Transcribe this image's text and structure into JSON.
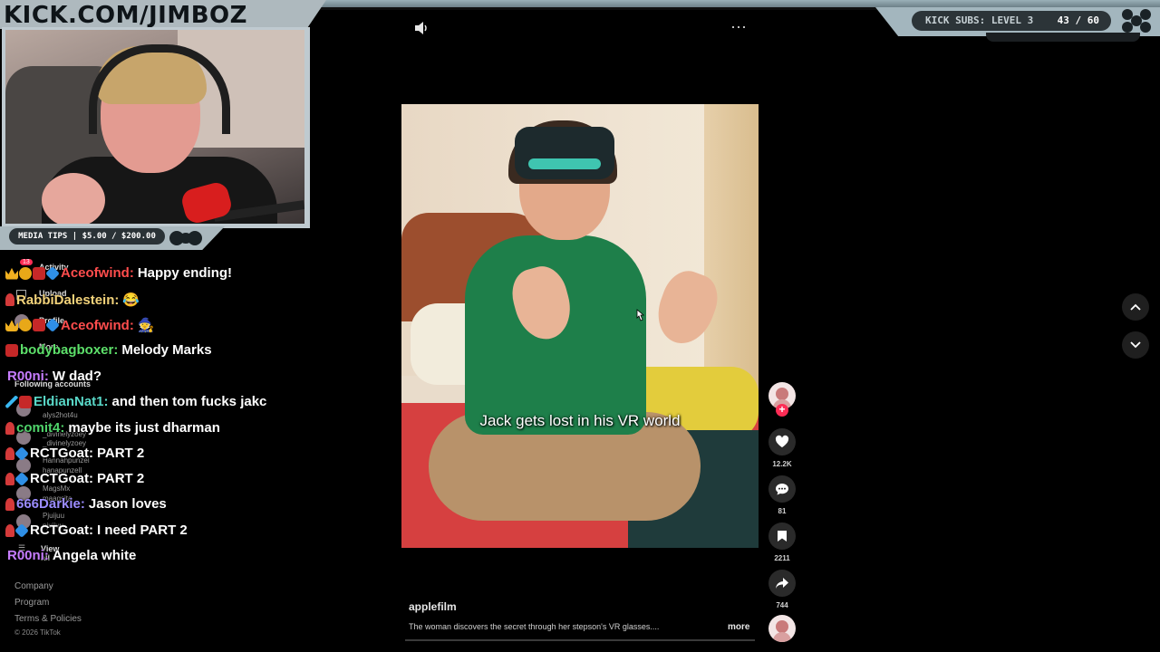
{
  "overlay": {
    "channel_title": "KICK.COM/JIMBOZ",
    "media_tips": "MEDIA TIPS | $5.00 / $200.00",
    "subs_label": "KICK SUBS: LEVEL 3",
    "subs_count": "43 / 60"
  },
  "sidebar": {
    "activity_badge": "13",
    "activity": "Activity",
    "upload": "Upload",
    "profile": "Profile",
    "more": "More",
    "following_title": "Following accounts",
    "accounts": [
      {
        "name": "",
        "handle": "alys2hot4u"
      },
      {
        "name": "_divinelyzoey",
        "handle": "_divinelyzoey"
      },
      {
        "name": "Hannahpunzel",
        "handle": "hanapunzell"
      },
      {
        "name": "MagsMx",
        "handle": "maagsita"
      },
      {
        "name": "Pjuijuu",
        "handle": "pjuijuu"
      }
    ],
    "view_all": "View all",
    "footer": {
      "company": "Company",
      "program": "Program",
      "terms": "Terms & Policies",
      "copyright": "© 2026 TikTok"
    }
  },
  "chat": [
    {
      "user": "Aceofwind:",
      "color": "#ff4d4d",
      "msg": "Happy ending!",
      "badges": [
        "crown",
        "num",
        "gift",
        "cube"
      ]
    },
    {
      "user": "RabbiDalestein:",
      "color": "#f2d27a",
      "msg": "😂",
      "badges": [
        "pawn"
      ]
    },
    {
      "user": "Aceofwind:",
      "color": "#ff4d4d",
      "msg": "🧙",
      "badges": [
        "crown",
        "num",
        "gift",
        "cube"
      ]
    },
    {
      "user": "bodybagboxer:",
      "color": "#5de06a",
      "msg": "Melody Marks",
      "badges": [
        "gift"
      ]
    },
    {
      "user": "R00ni:",
      "color": "#c77dff",
      "msg": "W dad?",
      "badges": []
    },
    {
      "user": "EldianNat1:",
      "color": "#59d8c8",
      "msg": "and then tom fucks jakc",
      "badges": [
        "sword",
        "gift"
      ]
    },
    {
      "user": "comit4:",
      "color": "#4fd36a",
      "msg": "maybe its just dharman",
      "badges": [
        "pawn"
      ]
    },
    {
      "user": "RCTGoat:",
      "color": "#ffffff",
      "msg": "PART 2",
      "badges": [
        "pawn",
        "cube"
      ]
    },
    {
      "user": "RCTGoat:",
      "color": "#ffffff",
      "msg": "PART 2",
      "badges": [
        "pawn",
        "cube"
      ]
    },
    {
      "user": "666Darkie:",
      "color": "#9b8cff",
      "msg": "Jason loves",
      "badges": [
        "pawn"
      ]
    },
    {
      "user": "RCTGoat:",
      "color": "#ffffff",
      "msg": "I need PART 2",
      "badges": [
        "pawn",
        "cube"
      ]
    },
    {
      "user": "R00ni:",
      "color": "#c77dff",
      "msg": "Angela white",
      "badges": []
    }
  ],
  "video": {
    "caption": "Jack gets lost in his VR world",
    "author": "applefilm",
    "description": "The woman discovers the secret through her stepson's VR glasses....",
    "more": "more",
    "likes": "12.2K",
    "comments": "81",
    "saves": "2211",
    "shares": "744",
    "icons": [
      "speaker-icon",
      "ellipsis-icon",
      "heart-icon",
      "comment-icon",
      "bookmark-icon",
      "share-icon",
      "chevron-up-icon",
      "chevron-down-icon"
    ]
  }
}
